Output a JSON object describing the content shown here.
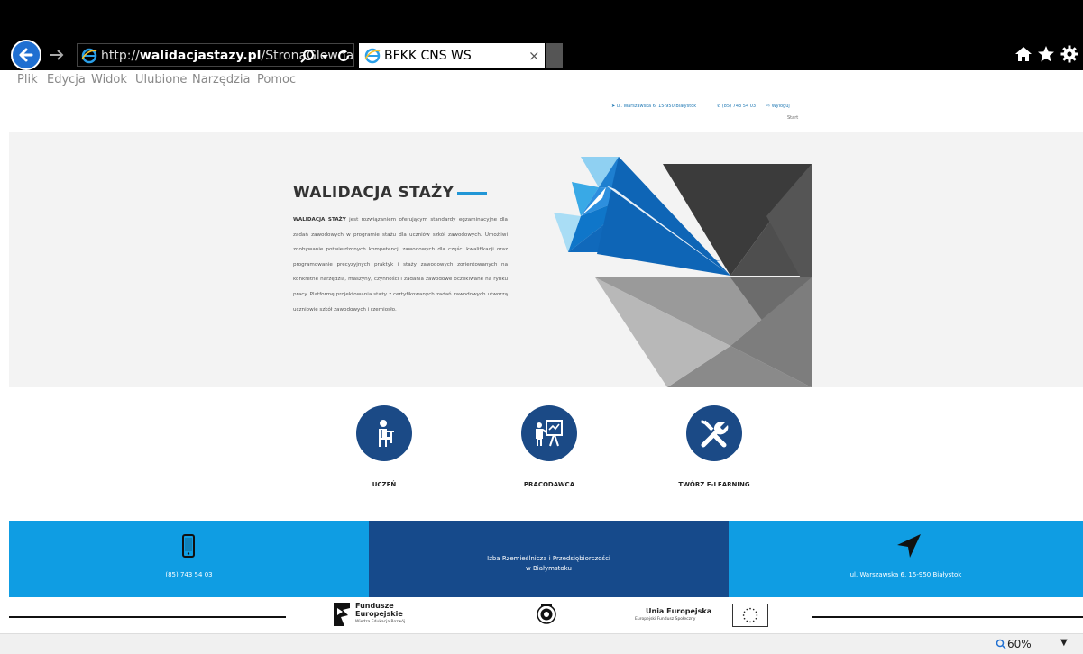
{
  "browser": {
    "url_prefix": "http://",
    "url_domain": "walidacjastazy.pl",
    "url_path": "/StronaGlowna",
    "tab_title": "BFKK CNS WS",
    "tab_close": "×",
    "menu": [
      "Plik",
      "Edycja",
      "Widok",
      "Ulubione",
      "Narzędzia",
      "Pomoc"
    ],
    "zoom": "60%"
  },
  "topinfo": {
    "address": "ul. Warszawska 6, 15-950 Białystok",
    "phone": "(85) 743 54 03",
    "logout": "Wyloguj",
    "start": "Start"
  },
  "hero": {
    "title": "WALIDACJA STAŻY",
    "text_bold": "WALIDACJA STAŻY",
    "text_body": " jest rozwiązaniem oferującym standardy egzaminacyjne dla zadań zawodowych w programie stażu dla uczniów szkół zawodowych. Umożliwi zdobywanie potwierdzonych kompetencji zawodowych dla części kwalifikacji oraz programowanie precyzyjnych praktyk i staży zawodowych zorientowanych na konkretne narzędzia, maszyny, czynności i zadania zawodowe oczekiwane na rynku pracy. Platformę projektowania staży z certyfikowanych zadań zawodowych utworzą uczniowie szkół zawodowych i rzemiosło.",
    "accent_color": "#2196d6"
  },
  "actions": [
    {
      "label": "UCZEŃ",
      "icon": "student-icon"
    },
    {
      "label": "PRACODAWCA",
      "icon": "teacher-icon"
    },
    {
      "label": "TWÓRZ E-LEARNING",
      "icon": "tools-icon"
    }
  ],
  "contact": {
    "phone": "(85) 743 54 03",
    "org_line1": "Izba Rzemieślnicza i Przedsiębiorczości",
    "org_line2": "w Białymstoku",
    "address": "ul. Warszawska 6, 15-950 Białystok",
    "light_blue": "#0f9de3",
    "dark_blue": "#164a8b"
  },
  "logos": {
    "fe_line1": "Fundusze",
    "fe_line2": "Europejskie",
    "fe_sub": "Wiedza Edukacja Rozwój",
    "ue_title": "Unia Europejska",
    "ue_sub": "Europejski Fundusz Społeczny"
  }
}
